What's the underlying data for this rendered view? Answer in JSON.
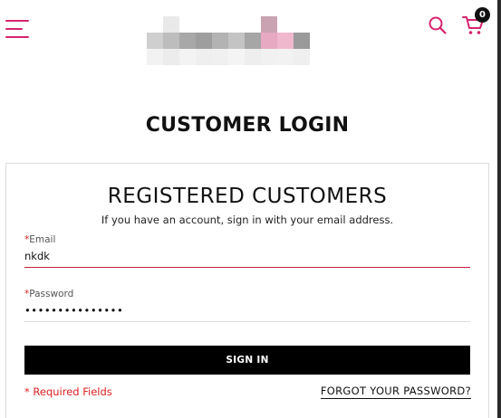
{
  "header": {
    "cart_count": "0",
    "brand_color": "#d6246e",
    "menu_icon": "hamburger-menu-icon",
    "search_icon": "search-icon",
    "cart_icon": "shopping-cart-icon"
  },
  "main": {
    "page_title": "CUSTOMER LOGIN"
  },
  "login": {
    "heading": "REGISTERED CUSTOMERS",
    "subtext": "If you have an account, sign in with your email address.",
    "email": {
      "required_mark": "*",
      "label": "Email",
      "value": "nkdk"
    },
    "password": {
      "required_mark": "*",
      "label": "Password",
      "value": "•••••••••••••••"
    },
    "signin_label": "SIGN IN",
    "required_note": "* Required Fields",
    "forgot_label": "FORGOT YOUR PASSWORD?"
  }
}
